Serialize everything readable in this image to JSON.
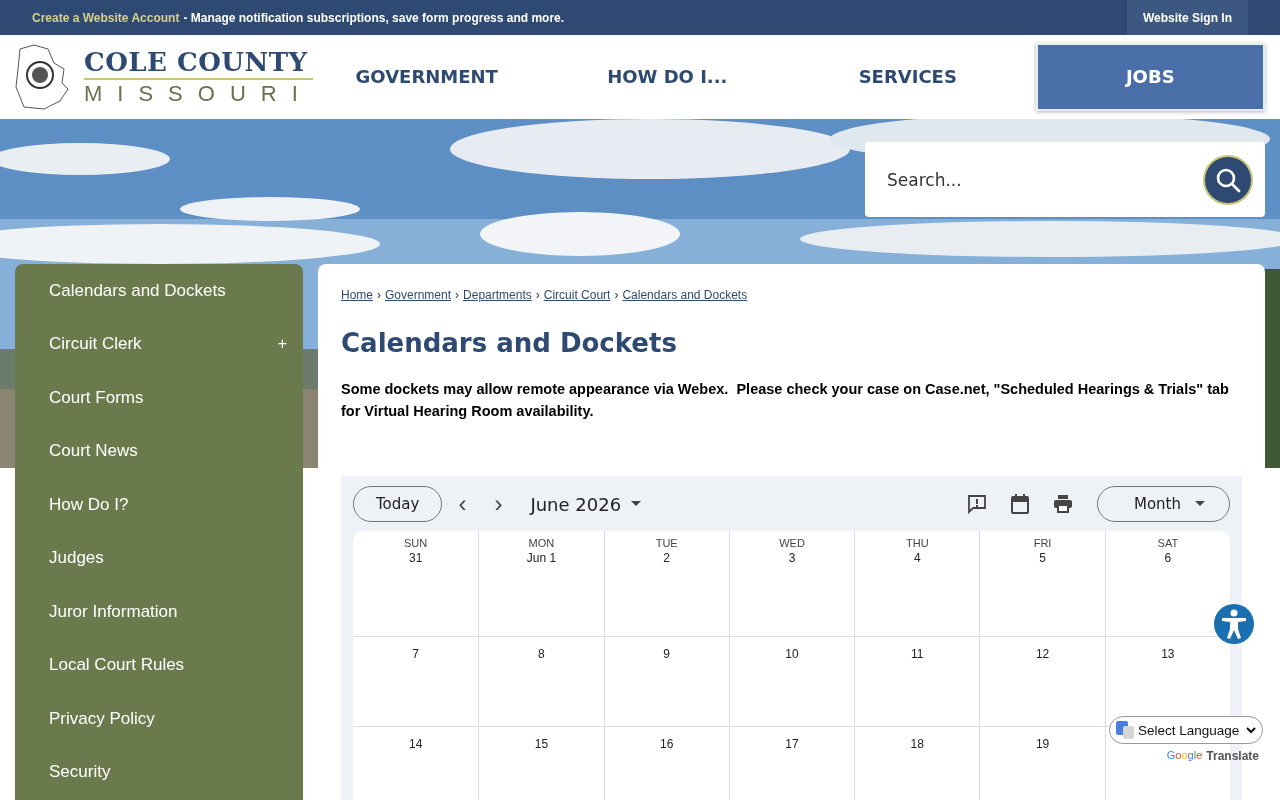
{
  "top_bar": {
    "account_link": "Create a Website Account",
    "account_note": "- Manage notification subscriptions, save form progress and more.",
    "sign_in": "Website Sign In"
  },
  "header": {
    "logo_title": "COLE COUNTY",
    "logo_subtitle": "MISSOURI",
    "nav": [
      {
        "label": "GOVERNMENT",
        "selected": false
      },
      {
        "label": "HOW DO I...",
        "selected": false
      },
      {
        "label": "SERVICES",
        "selected": false
      },
      {
        "label": "JOBS",
        "selected": true
      }
    ]
  },
  "search": {
    "placeholder": "Search..."
  },
  "sidebar": {
    "items": [
      {
        "label": "Calendars and Dockets"
      },
      {
        "label": "Circuit Clerk",
        "expander": "+"
      },
      {
        "label": "Court Forms"
      },
      {
        "label": "Court News"
      },
      {
        "label": "How Do I?"
      },
      {
        "label": "Judges"
      },
      {
        "label": "Juror Information"
      },
      {
        "label": "Local Court Rules"
      },
      {
        "label": "Privacy Policy"
      },
      {
        "label": "Security"
      }
    ]
  },
  "breadcrumbs": [
    "Home",
    "Government",
    "Departments",
    "Circuit Court",
    "Calendars and Dockets"
  ],
  "breadcrumb_separator": "›",
  "page_title": "Calendars and Dockets",
  "notice": "Some dockets may allow remote appearance via Webex.  Please check your case on Case.net, \"Scheduled Hearings & Trials\" tab for Virtual Hearing Room availability.",
  "calendar": {
    "today_button": "Today",
    "prev": "‹",
    "next": "›",
    "month_label": "June 2026",
    "view_button": "Month",
    "weekdays": [
      "SUN",
      "MON",
      "TUE",
      "WED",
      "THU",
      "FRI",
      "SAT"
    ],
    "weeks": [
      [
        "31",
        "Jun 1",
        "2",
        "3",
        "4",
        "5",
        "6"
      ],
      [
        "7",
        "8",
        "9",
        "10",
        "11",
        "12",
        "13"
      ],
      [
        "14",
        "15",
        "16",
        "17",
        "18",
        "19"
      ]
    ]
  },
  "translate": {
    "select": "Select Language",
    "brand": "Google",
    "label": "Translate"
  }
}
